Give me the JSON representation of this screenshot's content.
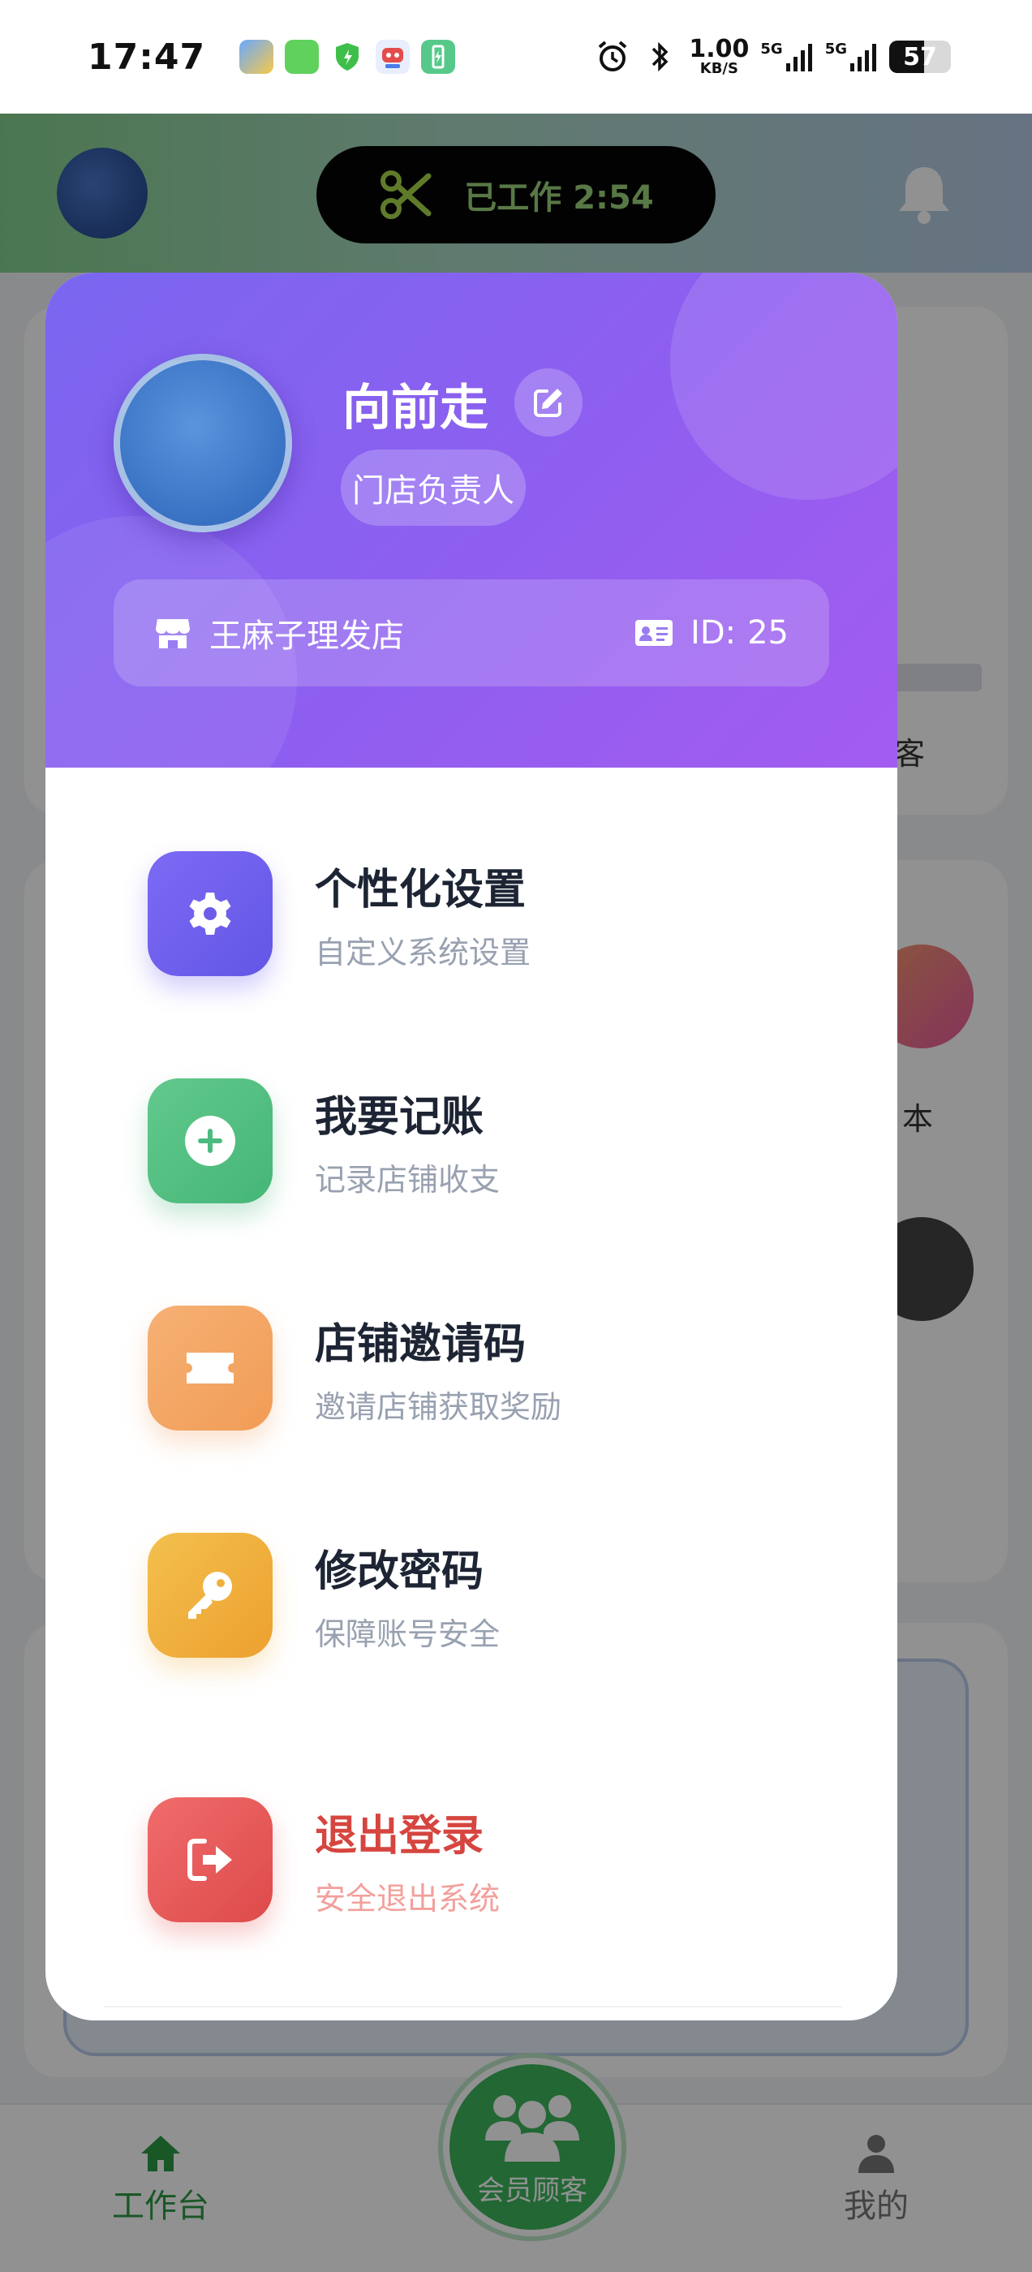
{
  "status_bar": {
    "time": "17:47",
    "net_speed_value": "1.00",
    "net_speed_unit": "KB/S",
    "signal1_label": "5G",
    "signal2_label": "5G",
    "battery_percent": "57",
    "battery_level": 0.57,
    "app_icons": [
      "weather-icon",
      "messages-icon",
      "security-shield-icon",
      "robot-app-icon",
      "battery-app-icon"
    ]
  },
  "header": {
    "work_status": "已工作 2:54",
    "icons": {
      "timer": "scissors-icon",
      "notification": "bell-icon"
    }
  },
  "background": {
    "partial_text_1": "客",
    "partial_text_2": "本"
  },
  "profile": {
    "name": "向前走",
    "role": "门店负责人",
    "store_name": "王麻子理发店",
    "store_id_label": "ID:",
    "store_id_value": "25"
  },
  "menu": {
    "items": [
      {
        "title": "个性化设置",
        "subtitle": "自定义系统设置",
        "icon": "gear-icon",
        "color": "#6c5ce7"
      },
      {
        "title": "我要记账",
        "subtitle": "记录店铺收支",
        "icon": "plus-circle-icon",
        "color": "#4cbb7f"
      },
      {
        "title": "店铺邀请码",
        "subtitle": "邀请店铺获取奖励",
        "icon": "ticket-icon",
        "color": "#f3a563"
      },
      {
        "title": "修改密码",
        "subtitle": "保障账号安全",
        "icon": "key-icon",
        "color": "#efb03c"
      }
    ],
    "logout": {
      "title": "退出登录",
      "subtitle": "安全退出系统",
      "icon": "logout-icon",
      "color": "#e05252"
    }
  },
  "bottom_nav": {
    "home": "工作台",
    "members": "会员顾客",
    "mine": "我的"
  },
  "colors": {
    "accent_purple": "#7a66f0",
    "success_green": "#3db55c",
    "danger_red": "#d6453f"
  }
}
